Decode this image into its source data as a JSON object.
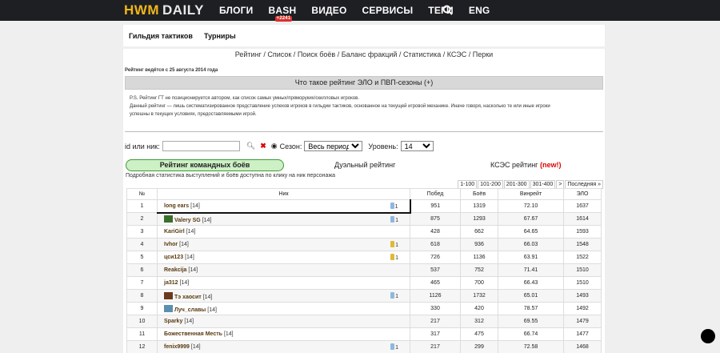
{
  "header": {
    "logo_a": "HWM",
    "logo_b": "DAILY",
    "nav": [
      {
        "label": "БЛОГИ"
      },
      {
        "label": "BASH",
        "badge": "+2241"
      },
      {
        "label": "ВИДЕО"
      },
      {
        "label": "СЕРВИСЫ"
      },
      {
        "label": "ТЕГИ"
      },
      {
        "label": "ENG"
      }
    ],
    "search_icon": "search-icon"
  },
  "subnav": [
    "Гильдия тактиков",
    "Турниры"
  ],
  "links": [
    "Рейтинг",
    "Список",
    "Поиск боёв",
    "Баланс фракций",
    "Статистика",
    "КСЭС",
    "Перки"
  ],
  "since": "Рейтинг ведётся с 25 августа 2014 года",
  "elo_bar": "Что такое рейтинг ЭЛО и ПВП-сезоны (+)",
  "ps": {
    "line1": "P.S. Рейтинг ГТ не позиционируется автором, как список самых умных/пряморуких/скилловых игроков.",
    "line2": "Данный рейтинг — лишь систематизированное представление успехов игроков в гильдии тактиков, основанное на текущей игровой механике. Иначе говоря, насколько те или иные игроки",
    "line3": "успешны в текущих условиях, предоставляемыми игрой."
  },
  "filter": {
    "id_label": "id или ник:",
    "season_label": "Сезон:",
    "season_value": "Весь период",
    "level_label": "Уровень:",
    "level_value": "14"
  },
  "tabs": {
    "team": "Рейтинг командных боёв",
    "duel": "Дуэльный рейтинг",
    "kses": "КСЭС рейтинг",
    "kses_new": "(new!)"
  },
  "hint": "Подробная статистика выступлений и боёв доступна по клику на ник персонажа",
  "pager": [
    "1-100",
    "101-200",
    "201-300",
    "301-400",
    ">",
    "Последняя »"
  ],
  "table": {
    "headers": [
      "№",
      "Ник",
      "Побед",
      "Боёв",
      "Винрейт",
      "ЭЛО"
    ],
    "rows": [
      {
        "n": "1",
        "nick": "long ears",
        "lvl": "[14]",
        "clan": "",
        "medal": "1",
        "medal_color": "#8fb7e0",
        "wins": "951",
        "fights": "1319",
        "wr": "72.10",
        "elo": "1637"
      },
      {
        "n": "2",
        "nick": "Valery SG",
        "lvl": "[14]",
        "clan": "#3a6e2a",
        "medal": "1",
        "medal_color": "#8fb7e0",
        "wins": "875",
        "fights": "1293",
        "wr": "67.67",
        "elo": "1614"
      },
      {
        "n": "3",
        "nick": "KariGirl",
        "lvl": "[14]",
        "clan": "",
        "medal": "",
        "medal_color": "",
        "wins": "428",
        "fights": "662",
        "wr": "64.65",
        "elo": "1593"
      },
      {
        "n": "4",
        "nick": "Ivhor",
        "lvl": "[14]",
        "clan": "",
        "medal": "1",
        "medal_color": "#e0b83a",
        "wins": "618",
        "fights": "936",
        "wr": "66.03",
        "elo": "1548"
      },
      {
        "n": "5",
        "nick": "цси123",
        "lvl": "[14]",
        "clan": "",
        "medal": "1",
        "medal_color": "#e0b83a",
        "wins": "726",
        "fights": "1136",
        "wr": "63.91",
        "elo": "1522"
      },
      {
        "n": "6",
        "nick": "Reakcija",
        "lvl": "[14]",
        "clan": "",
        "medal": "",
        "medal_color": "",
        "wins": "537",
        "fights": "752",
        "wr": "71.41",
        "elo": "1510"
      },
      {
        "n": "7",
        "nick": "ja312",
        "lvl": "[14]",
        "clan": "",
        "medal": "",
        "medal_color": "",
        "wins": "465",
        "fights": "700",
        "wr": "66.43",
        "elo": "1510"
      },
      {
        "n": "8",
        "nick": "Тэ хаосит",
        "lvl": "[14]",
        "clan": "#6b3a1e",
        "medal": "1",
        "medal_color": "#8fb7e0",
        "wins": "1126",
        "fights": "1732",
        "wr": "65.01",
        "elo": "1493"
      },
      {
        "n": "9",
        "nick": "Луч_славы",
        "lvl": "[14]",
        "clan": "#5a8fb0",
        "medal": "",
        "medal_color": "",
        "wins": "330",
        "fights": "420",
        "wr": "78.57",
        "elo": "1492"
      },
      {
        "n": "10",
        "nick": "Sparky",
        "lvl": "[14]",
        "clan": "",
        "medal": "",
        "medal_color": "",
        "wins": "217",
        "fights": "312",
        "wr": "69.55",
        "elo": "1479"
      },
      {
        "n": "11",
        "nick": "Божественная Месть",
        "lvl": "[14]",
        "clan": "",
        "medal": "",
        "medal_color": "",
        "wins": "317",
        "fights": "475",
        "wr": "66.74",
        "elo": "1477"
      },
      {
        "n": "12",
        "nick": "fenix9999",
        "lvl": "[14]",
        "clan": "",
        "medal": "1",
        "medal_color": "#8fb7e0",
        "wins": "217",
        "fights": "299",
        "wr": "72.58",
        "elo": "1468"
      }
    ]
  }
}
